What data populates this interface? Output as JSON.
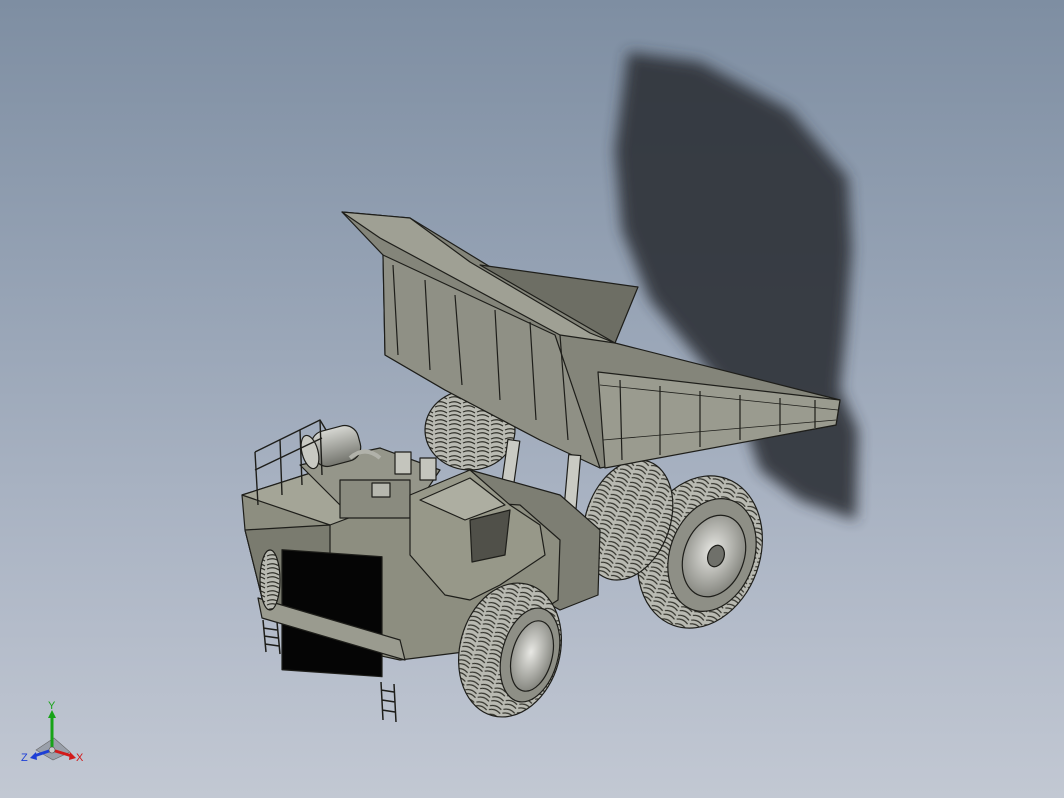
{
  "viewport": {
    "background_top": "#7e8ea2",
    "background_bottom": "#c2c8d3"
  },
  "model": {
    "subject": "mining-dump-truck",
    "dump_bed_raised": true,
    "body_color": "#8d8e80",
    "tire_color": "#b7b8b0",
    "line_color": "#1e1e1a",
    "shadow_color": "#2e3138",
    "grille_color": "#050505"
  },
  "triad": {
    "y_label": "Y",
    "z_label": "Z",
    "x_label": "X",
    "y_color": "#17a317",
    "z_color": "#1d3fd6",
    "x_color": "#d21a1a"
  }
}
